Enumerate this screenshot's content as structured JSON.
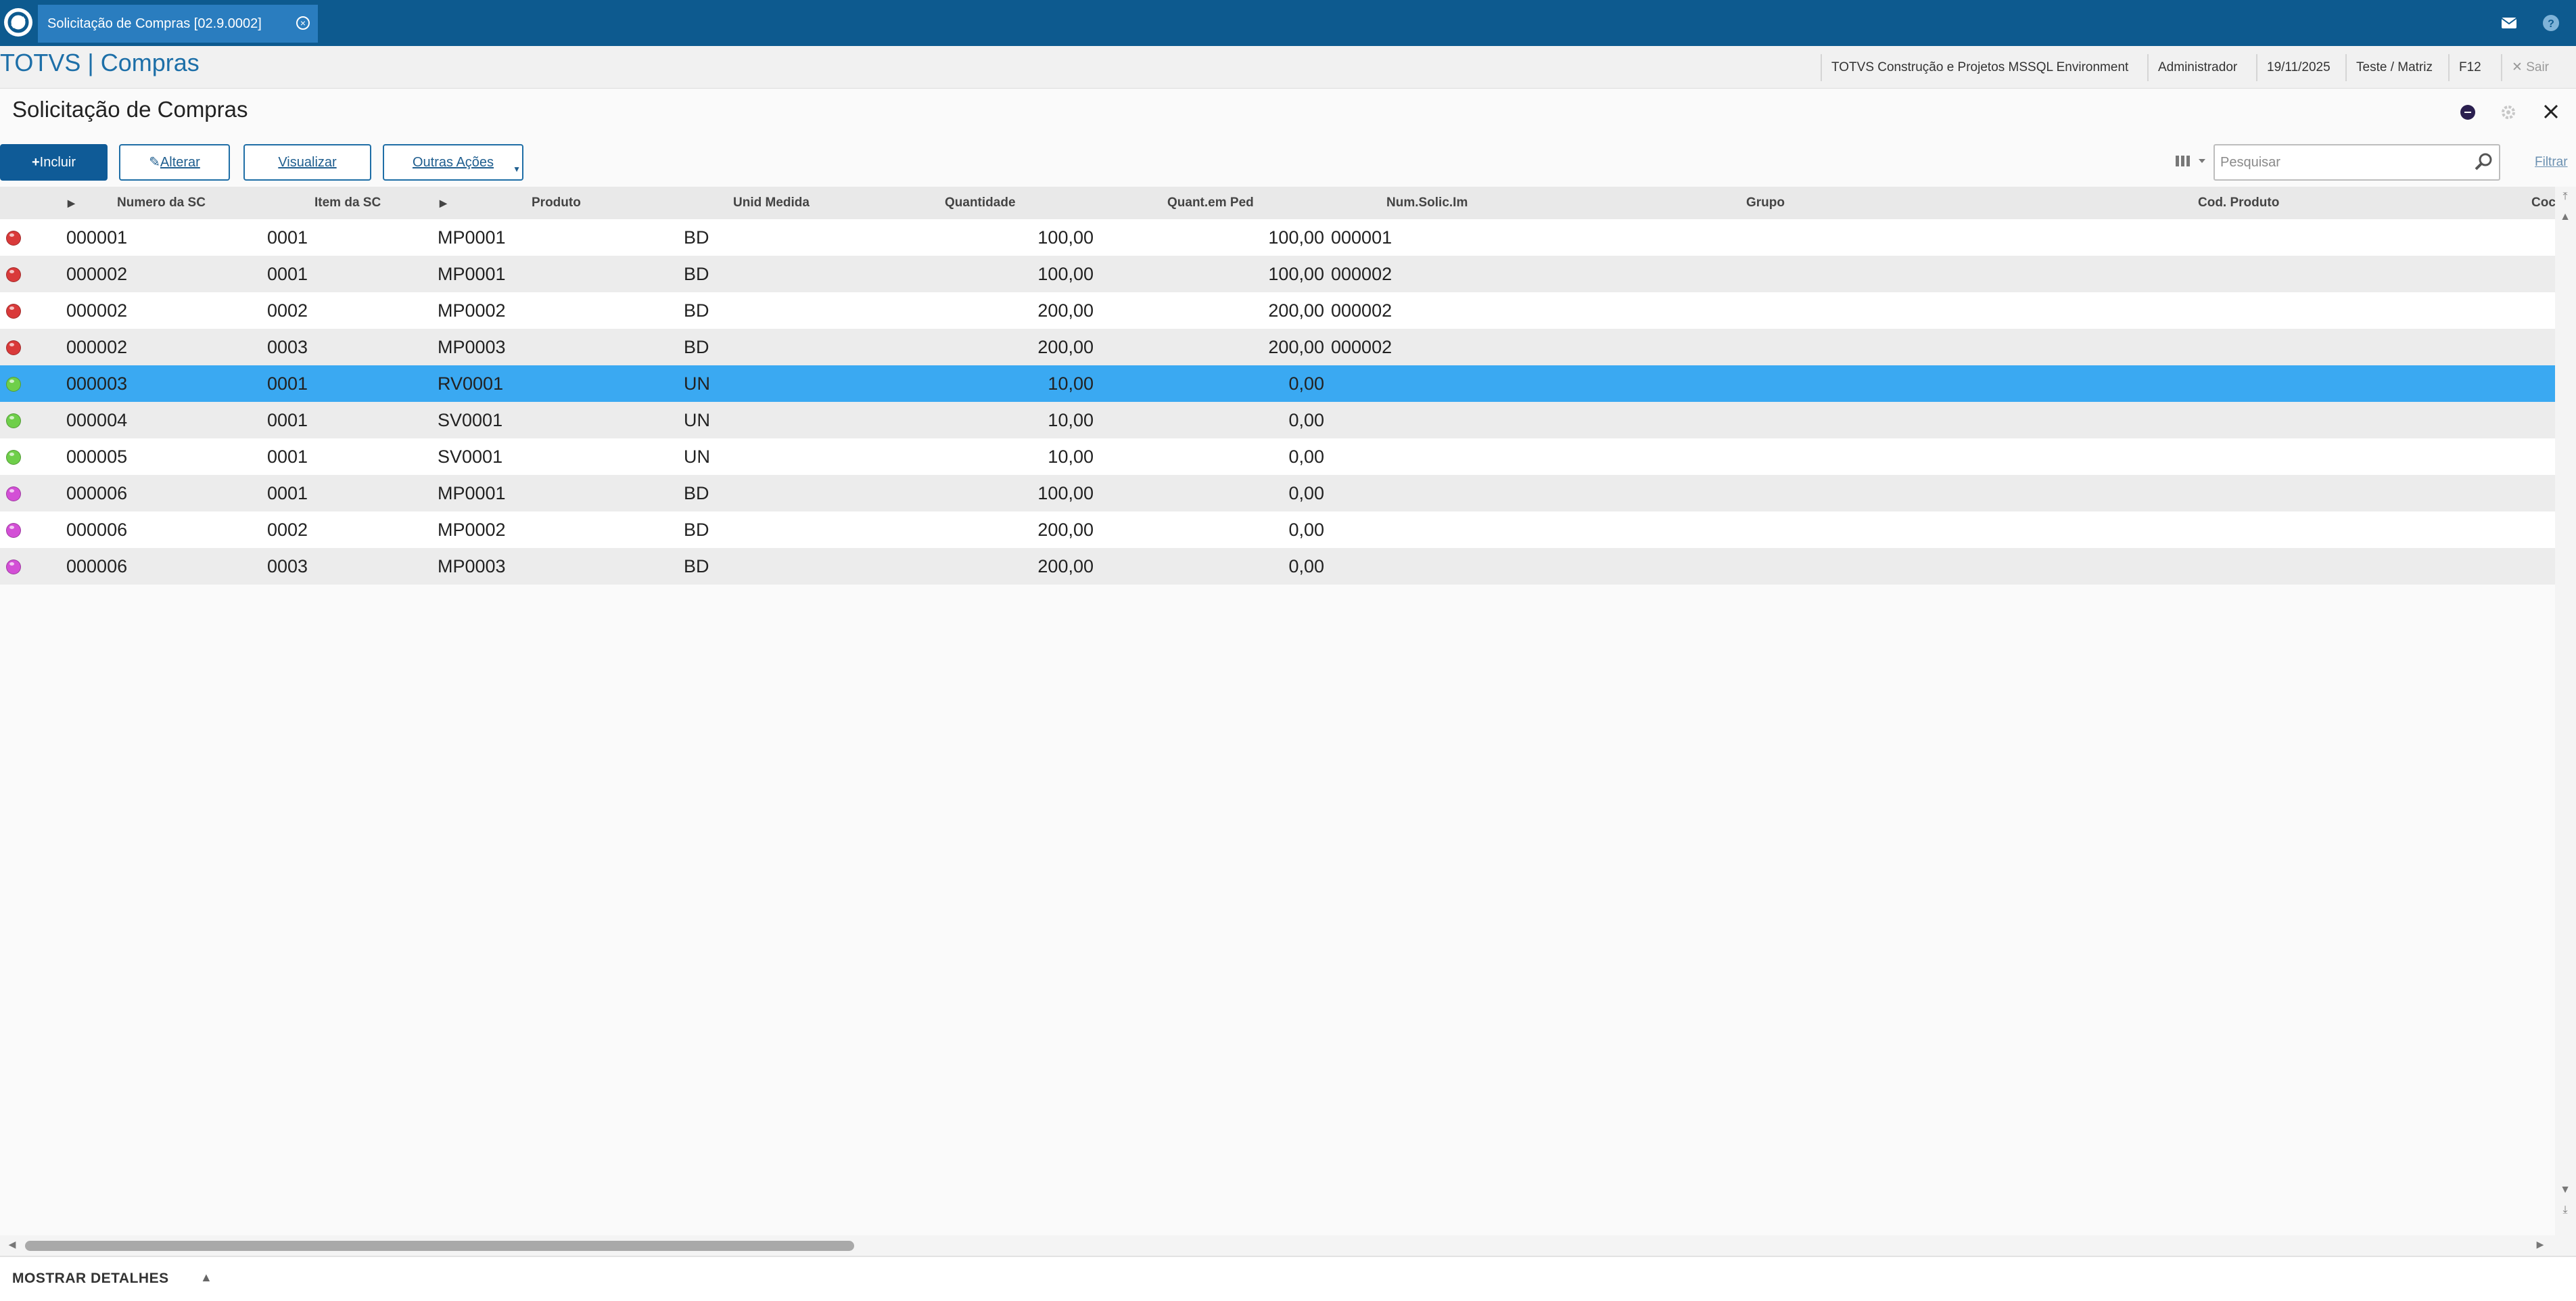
{
  "window_tab": {
    "label": "Solicitação de Compras [02.9.0002]",
    "close_glyph": "⊗"
  },
  "topbar_icons": [
    "mail-icon",
    "help-icon"
  ],
  "brand": "TOTVS | Compras",
  "info_bar": {
    "environment": "TOTVS Construção e Projetos MSSQL Environment",
    "user": "Administrador",
    "date": "19/11/2025",
    "branch": "Teste / Matriz",
    "shortcut": "F12",
    "exit_label": "Sair"
  },
  "page_title": "Solicitação de Compras",
  "toolbar": {
    "incluir": "Incluir",
    "alterar": "Alterar",
    "visualizar": "Visualizar",
    "outras_acoes": "Outras Ações",
    "search_placeholder": "Pesquisar",
    "filtrar": "Filtrar"
  },
  "columns": [
    "Numero da SC",
    "Item da SC",
    "Produto",
    "Unid Medida",
    "Quantidade",
    "Quant.em Ped",
    "Num.Solic.Im",
    "Grupo",
    "Cod. Produto",
    "Coc"
  ],
  "status_colors": {
    "red": "#d93a3a",
    "green": "#6fcf4a",
    "magenta": "#d34fd6"
  },
  "rows": [
    {
      "status": "red",
      "numero": "000001",
      "item": "0001",
      "produto": "MP0001",
      "unid": "BD",
      "quantidade": "100,00",
      "quant_ped": "100,00",
      "num_solic": "000001",
      "selected": false
    },
    {
      "status": "red",
      "numero": "000002",
      "item": "0001",
      "produto": "MP0001",
      "unid": "BD",
      "quantidade": "100,00",
      "quant_ped": "100,00",
      "num_solic": "000002",
      "selected": false
    },
    {
      "status": "red",
      "numero": "000002",
      "item": "0002",
      "produto": "MP0002",
      "unid": "BD",
      "quantidade": "200,00",
      "quant_ped": "200,00",
      "num_solic": "000002",
      "selected": false
    },
    {
      "status": "red",
      "numero": "000002",
      "item": "0003",
      "produto": "MP0003",
      "unid": "BD",
      "quantidade": "200,00",
      "quant_ped": "200,00",
      "num_solic": "000002",
      "selected": false
    },
    {
      "status": "green",
      "numero": "000003",
      "item": "0001",
      "produto": "RV0001",
      "unid": "UN",
      "quantidade": "10,00",
      "quant_ped": "0,00",
      "num_solic": "",
      "selected": true
    },
    {
      "status": "green",
      "numero": "000004",
      "item": "0001",
      "produto": "SV0001",
      "unid": "UN",
      "quantidade": "10,00",
      "quant_ped": "0,00",
      "num_solic": "",
      "selected": false
    },
    {
      "status": "green",
      "numero": "000005",
      "item": "0001",
      "produto": "SV0001",
      "unid": "UN",
      "quantidade": "10,00",
      "quant_ped": "0,00",
      "num_solic": "",
      "selected": false
    },
    {
      "status": "magenta",
      "numero": "000006",
      "item": "0001",
      "produto": "MP0001",
      "unid": "BD",
      "quantidade": "100,00",
      "quant_ped": "0,00",
      "num_solic": "",
      "selected": false
    },
    {
      "status": "magenta",
      "numero": "000006",
      "item": "0002",
      "produto": "MP0002",
      "unid": "BD",
      "quantidade": "200,00",
      "quant_ped": "0,00",
      "num_solic": "",
      "selected": false
    },
    {
      "status": "magenta",
      "numero": "000006",
      "item": "0003",
      "produto": "MP0003",
      "unid": "BD",
      "quantidade": "200,00",
      "quant_ped": "0,00",
      "num_solic": "",
      "selected": false
    }
  ],
  "footer": {
    "details_label": "MOSTRAR DETALHES"
  }
}
